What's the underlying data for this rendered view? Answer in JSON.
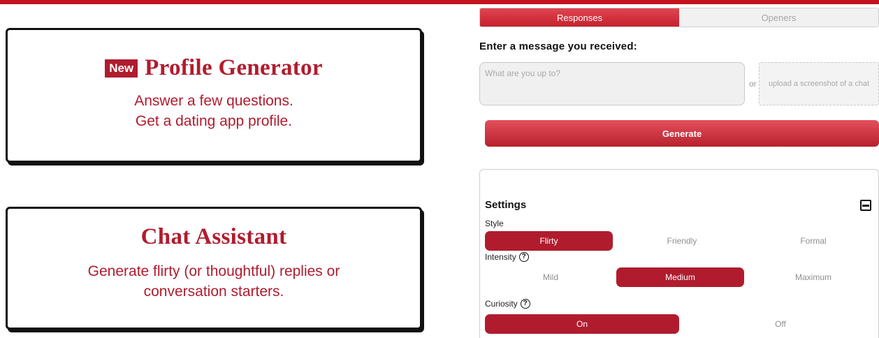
{
  "colors": {
    "accent": "#b01c2e",
    "topbar": "#c4121f"
  },
  "cards": {
    "profile": {
      "badge": "New",
      "title": "Profile Generator",
      "line1": "Answer a few questions.",
      "line2": "Get a dating app profile."
    },
    "chat": {
      "title": "Chat Assistant",
      "line1": "Generate flirty (or thoughtful) replies or",
      "line2": "conversation starters."
    }
  },
  "tabs": [
    {
      "label": "Responses",
      "active": true
    },
    {
      "label": "Openers",
      "active": false
    }
  ],
  "prompt_label": "Enter a message you received:",
  "message_input": {
    "value": "",
    "placeholder": "What are you up to?"
  },
  "or_text": "or",
  "upload_label": "upload a screenshot of a chat",
  "generate_label": "Generate",
  "settings": {
    "title": "Settings",
    "collapse_icon": "minus-square-icon",
    "style": {
      "label": "Style",
      "options": [
        "Flirty",
        "Friendly",
        "Formal"
      ],
      "selected": "Flirty"
    },
    "intensity": {
      "label": "Intensity",
      "options": [
        "Mild",
        "Medium",
        "Maximum"
      ],
      "selected": "Medium"
    },
    "curiosity": {
      "label": "Curiosity",
      "options": [
        "On",
        "Off"
      ],
      "selected": "On"
    }
  }
}
